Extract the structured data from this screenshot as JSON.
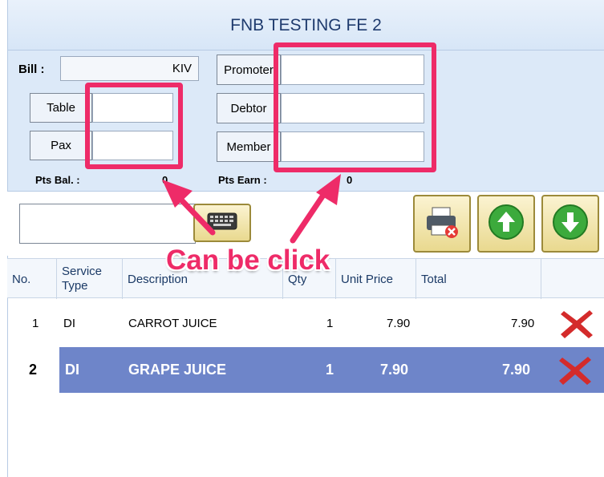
{
  "window": {
    "title": "FNB TESTING FE 2"
  },
  "bill": {
    "label": "Bill :",
    "value": "KIV"
  },
  "fields": {
    "table_label": "Table",
    "table_value": "",
    "pax_label": "Pax",
    "pax_value": "",
    "promoter_label": "Promoter",
    "promoter_value": "",
    "debtor_label": "Debtor",
    "debtor_value": "",
    "member_label": "Member",
    "member_value": ""
  },
  "points": {
    "bal_label": "Pts Bal. :",
    "bal_value": "0",
    "earn_label": "Pts Earn :",
    "earn_value": "0"
  },
  "toolbar": {
    "search_value": "",
    "keyboard_icon": "keyboard-icon",
    "print_icon": "printer-cancel-icon",
    "up_icon": "arrow-up-icon",
    "down_icon": "arrow-down-icon"
  },
  "grid": {
    "headers": [
      "No.",
      "Service\nType",
      "Description",
      "Qty",
      "Unit Price",
      "Total",
      ""
    ],
    "rows": [
      {
        "no": "1",
        "service": "DI",
        "description": "CARROT JUICE",
        "qty": "1",
        "unit_price": "7.90",
        "total": "7.90"
      },
      {
        "no": "2",
        "service": "DI",
        "description": "GRAPE JUICE",
        "qty": "1",
        "unit_price": "7.90",
        "total": "7.90"
      }
    ]
  },
  "annotation": {
    "text": "Can be click",
    "color": "#ee2b68"
  },
  "colors": {
    "selected_row": "#6e85c9",
    "title_text": "#1f3b6e",
    "delete_red": "#d42b2b"
  }
}
